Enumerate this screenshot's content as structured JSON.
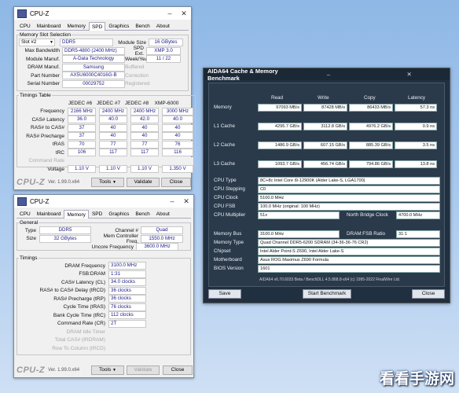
{
  "cpuz1": {
    "title": "CPU-Z",
    "tabs": [
      "CPU",
      "Mainboard",
      "Memory",
      "SPD",
      "Graphics",
      "Bench",
      "About"
    ],
    "active_tab": "SPD",
    "slot_legend": "Memory Slot Selection",
    "slot_value": "Slot #2",
    "slot_type": "DDR5",
    "module_size_label": "Module Size",
    "module_size": "16 GBytes",
    "max_bw_label": "Max Bandwidth",
    "max_bw": "DDR5-4800 (2400 MHz)",
    "spd_ext_label": "SPD Ext.",
    "spd_ext": "XMP 3.0",
    "module_manuf_label": "Module Manuf.",
    "module_manuf": "A-Data Technology",
    "week_year_label": "Week/Year",
    "week_year": "11 / 22",
    "dram_manuf_label": "DRAM Manuf.",
    "dram_manuf": "Samsung",
    "buffered_label": "Buffered",
    "part_label": "Part Number",
    "part": "AX5U6000C4016G-B",
    "correction_label": "Correction",
    "serial_label": "Serial Number",
    "serial": "00029752",
    "registered_label": "Registered",
    "timings_legend": "Timings Table",
    "jedec_cols": [
      "JEDEC #6",
      "JEDEC #7",
      "JEDEC #8",
      "XMP-6000"
    ],
    "timing_rows": [
      {
        "label": "Frequency",
        "vals": [
          "2166 MHz",
          "2400 MHz",
          "2400 MHz",
          "3000 MHz"
        ],
        "dim": false
      },
      {
        "label": "CAS# Latency",
        "vals": [
          "36.0",
          "40.0",
          "42.0",
          "40.0"
        ],
        "dim": false
      },
      {
        "label": "RAS# to CAS#",
        "vals": [
          "37",
          "40",
          "40",
          "40"
        ],
        "dim": false
      },
      {
        "label": "RAS# Precharge",
        "vals": [
          "37",
          "40",
          "40",
          "40"
        ],
        "dim": false
      },
      {
        "label": "tRAS",
        "vals": [
          "70",
          "77",
          "77",
          "76"
        ],
        "dim": false
      },
      {
        "label": "tRC",
        "vals": [
          "106",
          "117",
          "117",
          "116"
        ],
        "dim": false
      },
      {
        "label": "Command Rate",
        "vals": [
          "",
          "",
          "",
          ""
        ],
        "dim": true
      },
      {
        "label": "Voltage",
        "vals": [
          "1.10 V",
          "1.10 V",
          "1.10 V",
          "1.350 V"
        ],
        "dim": false
      }
    ],
    "brand": "CPU-Z",
    "version": "Ver. 1.99.0.x64",
    "tools": "Tools",
    "validate": "Validate",
    "close": "Close"
  },
  "cpuz2": {
    "title": "CPU-Z",
    "tabs": [
      "CPU",
      "Mainboard",
      "Memory",
      "SPD",
      "Graphics",
      "Bench",
      "About"
    ],
    "active_tab": "Memory",
    "general_legend": "General",
    "type_label": "Type",
    "type": "DDR5",
    "channel_label": "Channel #",
    "channel": "Quad",
    "size_label": "Size",
    "size": "32 GBytes",
    "mcf_label": "Mem Controller Freq.",
    "mcf": "1550.0 MHz",
    "uncore_label": "Uncore Frequency",
    "uncore": "3600.0 MHz",
    "timings_legend": "Timings",
    "timings": [
      {
        "label": "DRAM Frequency",
        "val": "3100.0 MHz",
        "dim": false
      },
      {
        "label": "FSB:DRAM",
        "val": "1:31",
        "dim": false
      },
      {
        "label": "CAS# Latency (CL)",
        "val": "34.0 clocks",
        "dim": false
      },
      {
        "label": "RAS# to CAS# Delay (tRCD)",
        "val": "36 clocks",
        "dim": false
      },
      {
        "label": "RAS# Precharge (tRP)",
        "val": "36 clocks",
        "dim": false
      },
      {
        "label": "Cycle Time (tRAS)",
        "val": "76 clocks",
        "dim": false
      },
      {
        "label": "Bank Cycle Time (tRC)",
        "val": "112 clocks",
        "dim": false
      },
      {
        "label": "Command Rate (CR)",
        "val": "2T",
        "dim": false
      },
      {
        "label": "DRAM Idle Timer",
        "val": "",
        "dim": true
      },
      {
        "label": "Total CAS# (tRDRAM)",
        "val": "",
        "dim": true
      },
      {
        "label": "Row To Column (tRCD)",
        "val": "",
        "dim": true
      }
    ],
    "brand": "CPU-Z",
    "version": "Ver. 1.99.0.x64",
    "tools": "Tools",
    "validate": "Validate",
    "close": "Close"
  },
  "aida": {
    "title": "AIDA64 Cache & Memory Benchmark",
    "cols": [
      "Read",
      "Write",
      "Copy",
      "Latency"
    ],
    "rows": [
      {
        "label": "Memory",
        "vals": [
          "97093 MB/s",
          "87428 MB/s",
          "86433 MB/s",
          "57.3 ns"
        ]
      },
      {
        "label": "L1 Cache",
        "vals": [
          "4295.7 GB/s",
          "3112.8 GB/s",
          "4976.2 GB/s",
          "0.9 ns"
        ]
      },
      {
        "label": "L2 Cache",
        "vals": [
          "1486.9 GB/s",
          "607.15 GB/s",
          "885.39 GB/s",
          "3.5 ns"
        ]
      },
      {
        "label": "L3 Cache",
        "vals": [
          "1093.7 GB/s",
          "456.74 GB/s",
          "794.86 GB/s",
          "13.8 ns"
        ]
      }
    ],
    "cpu_type_label": "CPU Type",
    "cpu_type": "8C+8c Intel Core i9-12900K  (Alder Lake-S, LGA1700)",
    "cpu_stepping_label": "CPU Stepping",
    "cpu_stepping": "C0",
    "cpu_clock_label": "CPU Clock",
    "cpu_clock": "5100.0 MHz",
    "cpu_fsb_label": "CPU FSB",
    "cpu_fsb": "100.0 MHz  (original: 100 MHz)",
    "cpu_mult_label": "CPU Multiplier",
    "cpu_mult": "51x",
    "nb_clock_label": "North Bridge Clock",
    "nb_clock": "4700.0 MHz",
    "mem_bus_label": "Memory Bus",
    "mem_bus": "3100.0 MHz",
    "dram_fsb_label": "DRAM:FSB Ratio",
    "dram_fsb": "31:1",
    "mem_type_label": "Memory Type",
    "mem_type": "Quad Channel DDR5-6200 SDRAM  (34-36-36-76 CR2)",
    "chipset_label": "Chipset",
    "chipset": "Intel Alder Point-S Z690, Intel Alder Lake-S",
    "mobo_label": "Motherboard",
    "mobo": "Asus ROG Maximus Z690 Formula",
    "bios_label": "BIOS Version",
    "bios": "1601",
    "footer": "AIDA64 v6.70.6033 Beta / BenchDLL 4.5.868.8-x64  (c) 1995-2022 FinalWire Ltd.",
    "save": "Save",
    "start": "Start Benchmark",
    "close": "Close"
  },
  "watermark": "看看手游网"
}
